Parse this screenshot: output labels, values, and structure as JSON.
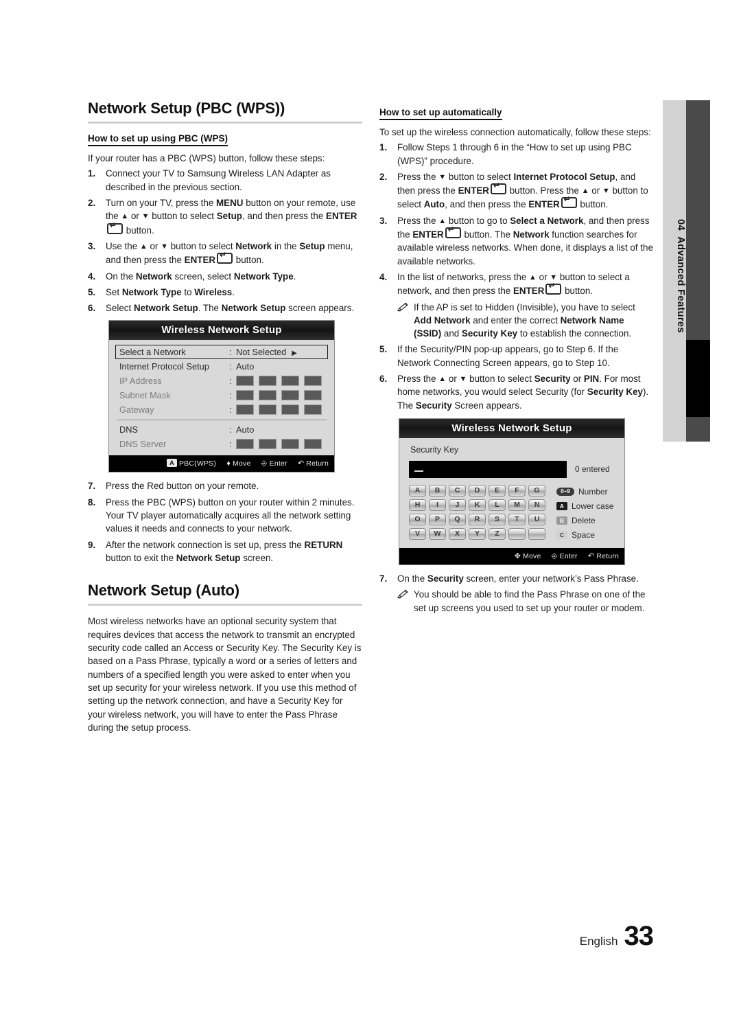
{
  "sidebar_tab": {
    "number": "04",
    "label": "Advanced Features",
    "text": "04  Advanced Features"
  },
  "left": {
    "heading": "Network Setup (PBC (WPS))",
    "subheading": "How to set up using PBC (WPS)",
    "intro": "If your router has a PBC (WPS) button, follow these steps:",
    "steps": [
      {
        "num": "1.",
        "html": "Connect your TV to Samsung Wireless LAN Adapter as described in the previous section."
      },
      {
        "num": "2.",
        "html": "Turn on your TV, press the <b>MENU</b> button on your remote, use the <span class=\"arrow\">&#9650;</span> or <span class=\"arrow\">&#9660;</span> button to select <b>Setup</b>, and then press the <b>ENTER</b><span class=\"ent\"></span> button."
      },
      {
        "num": "3.",
        "html": "Use the <span class=\"arrow\">&#9650;</span> or <span class=\"arrow\">&#9660;</span> button to select <b>Network</b> in the <b>Setup</b> menu, and then press the <b>ENTER</b><span class=\"ent\"></span> button."
      },
      {
        "num": "4.",
        "html": "On the <b>Network</b> screen, select <b>Network Type</b>."
      },
      {
        "num": "5.",
        "html": "Set <b>Network Type</b> to <b>Wireless</b>."
      },
      {
        "num": "6.",
        "html": "Select <b>Network Setup</b>. The <b>Network Setup</b> screen appears."
      }
    ],
    "steps2": [
      {
        "num": "7.",
        "html": "Press the Red button on your remote."
      },
      {
        "num": "8.",
        "html": "Press the PBC (WPS) button on your router within 2 minutes. Your TV player automatically acquires all the network setting values it needs and connects to your network."
      },
      {
        "num": "9.",
        "html": "After the network connection is set up, press the <b>RETURN</b> button to exit the <b>Network Setup</b> screen."
      }
    ],
    "heading2": "Network Setup (Auto)",
    "paragraph2": "Most wireless networks have an optional security system that requires devices that access the network to transmit an encrypted security code called an Access or Security Key. The Security Key is based on a Pass Phrase, typically a word or a series of letters and numbers of a specified length you were asked to enter when you set up security for your wireless network. If you use this method of setting up the network connection, and have a Security Key for your wireless network, you will have to enter the Pass Phrase during the setup process."
  },
  "osd_network": {
    "title": "Wireless Network Setup",
    "rows": [
      {
        "label": "Select a Network",
        "value": "Not Selected",
        "type": "text",
        "selected": true,
        "arrow": true
      },
      {
        "label": "Internet Protocol Setup",
        "value": "Auto",
        "type": "text"
      },
      {
        "label": "IP Address",
        "value": "",
        "type": "boxes",
        "dim": true
      },
      {
        "label": "Subnet Mask",
        "value": "",
        "type": "boxes",
        "dim": true
      },
      {
        "label": "Gateway",
        "value": "",
        "type": "boxes",
        "dim": true
      },
      {
        "label": "DNS",
        "value": "Auto",
        "type": "text"
      },
      {
        "label": "DNS Server",
        "value": "",
        "type": "boxes",
        "dim": true
      }
    ],
    "footer": [
      {
        "badge": "A",
        "label": "PBC(WPS)"
      },
      {
        "glyph": "move-updown",
        "label": "Move"
      },
      {
        "glyph": "enter",
        "label": "Enter"
      },
      {
        "glyph": "return",
        "label": "Return"
      }
    ]
  },
  "right": {
    "subheading": "How to set up automatically",
    "intro": "To set up the wireless connection automatically, follow these steps:",
    "steps": [
      {
        "num": "1.",
        "html": "Follow Steps 1 through 6 in the &#8220;How to set up using PBC (WPS)&#8221; procedure."
      },
      {
        "num": "2.",
        "html": "Press the <span class=\"arrow\">&#9660;</span> button to select <b>Internet Protocol Setup</b>, and then press the <b>ENTER</b><span class=\"ent\"></span> button. Press the <span class=\"arrow\">&#9650;</span> or <span class=\"arrow\">&#9660;</span> button to select <b>Auto</b>, and then press the <b>ENTER</b><span class=\"ent\"></span> button."
      },
      {
        "num": "3.",
        "html": "Press the <span class=\"arrow\">&#9650;</span> button to go to <b>Select a Network</b>, and then press the <b>ENTER</b><span class=\"ent\"></span> button. The <b>Network</b> function searches for available wireless networks. When done, it displays a list of the available networks."
      },
      {
        "num": "4.",
        "html": "In the list of networks, press the <span class=\"arrow\">&#9650;</span> or <span class=\"arrow\">&#9660;</span> button to select a network, and then press the <b>ENTER</b><span class=\"ent\"></span> button."
      }
    ],
    "note1": "If the AP is set to Hidden (Invisible), you have to select <b>Add Network</b> and enter the correct <b>Network Name (SSID)</b> and <b>Security Key</b> to establish the connection.",
    "steps2": [
      {
        "num": "5.",
        "html": "If the Security/PIN pop-up appears, go to Step 6. If the Network Connecting Screen appears, go to Step 10."
      },
      {
        "num": "6.",
        "html": "Press the <span class=\"arrow\">&#9650;</span> or <span class=\"arrow\">&#9660;</span> button to select <b>Security</b> or <b>PIN</b>. For most home networks, you would select Security (for <b>Security Key</b>). The <b>Security</b> Screen appears."
      }
    ],
    "steps3": [
      {
        "num": "7.",
        "html": "On the <b>Security</b> screen, enter your network&#8217;s Pass Phrase."
      }
    ],
    "note2": "You should be able to find the Pass Phrase on one of the set up screens you used to set up your router or modem."
  },
  "osd_security": {
    "title": "Wireless Network Setup",
    "field_label": "Security Key",
    "input_value": "",
    "entered_count": "0 entered",
    "keyboard_rows": [
      [
        "A",
        "B",
        "C",
        "D",
        "E",
        "F",
        "G"
      ],
      [
        "H",
        "I",
        "J",
        "K",
        "L",
        "M",
        "N"
      ],
      [
        "O",
        "P",
        "Q",
        "R",
        "S",
        "T",
        "U"
      ],
      [
        "V",
        "W",
        "X",
        "Y",
        "Z",
        "",
        ""
      ]
    ],
    "legend": [
      {
        "badge": "0~9",
        "label": "Number",
        "kind": "num"
      },
      {
        "badge": "A",
        "label": "Lower case",
        "kind": "a"
      },
      {
        "badge": "B",
        "label": "Delete",
        "kind": "b"
      },
      {
        "badge": "C",
        "label": "Space",
        "kind": "c"
      }
    ],
    "footer": [
      {
        "glyph": "move-4way",
        "label": "Move"
      },
      {
        "glyph": "enter",
        "label": "Enter"
      },
      {
        "glyph": "return",
        "label": "Return"
      }
    ]
  },
  "page_footer": {
    "language": "English",
    "page_number": "33"
  },
  "colors": {
    "accent_gray": "#d2d2d2",
    "tab_dark": "#4a4a4a",
    "rule": "#cfcfcf",
    "osd_panel": "#d9d9d9"
  }
}
